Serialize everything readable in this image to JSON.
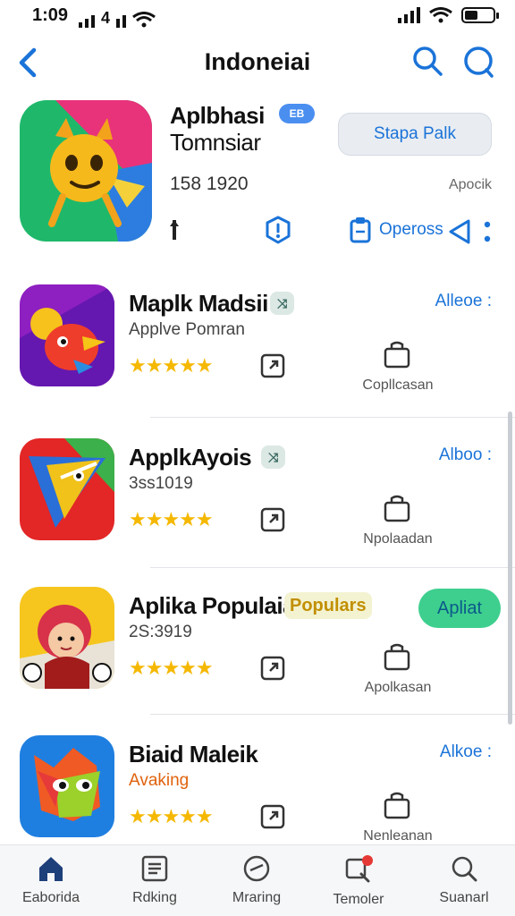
{
  "status": {
    "time": "1:09",
    "carrier_text": "4"
  },
  "nav": {
    "title": "Indoneiai"
  },
  "featured": {
    "name_line1": "Aplbhasi",
    "name_line2": "Tomnsiar",
    "badge": "EB",
    "count": "158 1920",
    "open_button": "Stapa Palk",
    "developer": "Apocik",
    "options_label": "Opeross"
  },
  "apps": [
    {
      "name": "Maplk Madsii",
      "tag": "⤨",
      "subtitle": "Applve Pomran",
      "rating": "★★★★★",
      "action_link": "Alleoe :",
      "bag_label": "Copllcasan"
    },
    {
      "name": "ApplkAyois",
      "tag": "⤨",
      "subtitle": "3ss1019",
      "rating": "★★★★★",
      "action_link": "Alboo :",
      "bag_label": "Npolaadan"
    },
    {
      "name": "Aplika Populaia",
      "tag": "Populars",
      "subtitle": "2S:3919",
      "rating": "★★★★★",
      "action_button": "Apliat",
      "bag_label": "Apolkasan"
    },
    {
      "name": "Biaid Maleik",
      "subtitle": "Avaking",
      "rating": "★★★★★",
      "action_link": "Alkoe :",
      "bag_label": "Nenleanan"
    }
  ],
  "tabs": [
    {
      "label": "Eaborida",
      "icon": "home-icon"
    },
    {
      "label": "Rdking",
      "icon": "list-icon"
    },
    {
      "label": "Mraring",
      "icon": "compass-icon"
    },
    {
      "label": "Temoler",
      "icon": "notification-icon"
    },
    {
      "label": "Suanarl",
      "icon": "search-icon"
    }
  ],
  "colors": {
    "accent": "#1a73d8",
    "star": "#f5b800",
    "green_button": "#3ecf8e",
    "badge_red": "#e53935"
  }
}
